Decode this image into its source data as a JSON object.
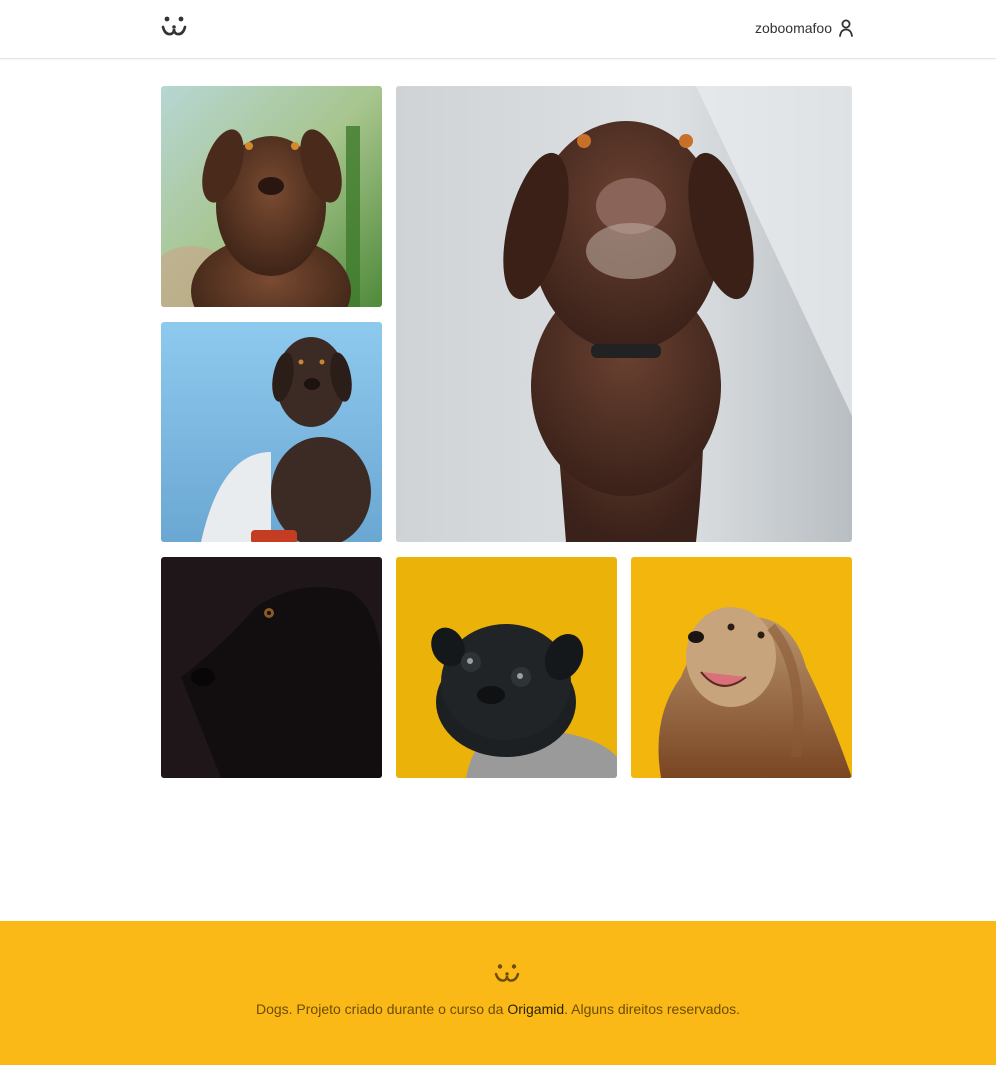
{
  "header": {
    "logo_icon": "dog-face-icon",
    "username": "zoboomafoo",
    "user_icon": "user-icon"
  },
  "feed": {
    "photos": [
      {
        "subject": "chocolate labrador, green background",
        "colors": [
          "#8a5a3c",
          "#5a3a26",
          "#a9c9a0"
        ]
      },
      {
        "subject": "chocolate labrador sitting on concrete",
        "colors": [
          "#5d3a2a",
          "#d8dcdf"
        ]
      },
      {
        "subject": "chocolate labrador, blue background",
        "colors": [
          "#3c2a22",
          "#9ccfe8"
        ]
      },
      {
        "subject": "black dog profile, dark background",
        "colors": [
          "#1d1618",
          "#0e0b0c"
        ]
      },
      {
        "subject": "black pug in sweater, yellow background",
        "colors": [
          "#eab20a",
          "#1b1d1f"
        ]
      },
      {
        "subject": "afghan hound, yellow background",
        "colors": [
          "#f2b50d",
          "#8b5a32"
        ]
      }
    ]
  },
  "footer": {
    "logo_icon": "dog-face-icon",
    "text_before": "Dogs. Projeto criado durante o curso da ",
    "brand": "Origamid",
    "text_after": ". Alguns direitos reservados.",
    "background": "#fbb917"
  }
}
